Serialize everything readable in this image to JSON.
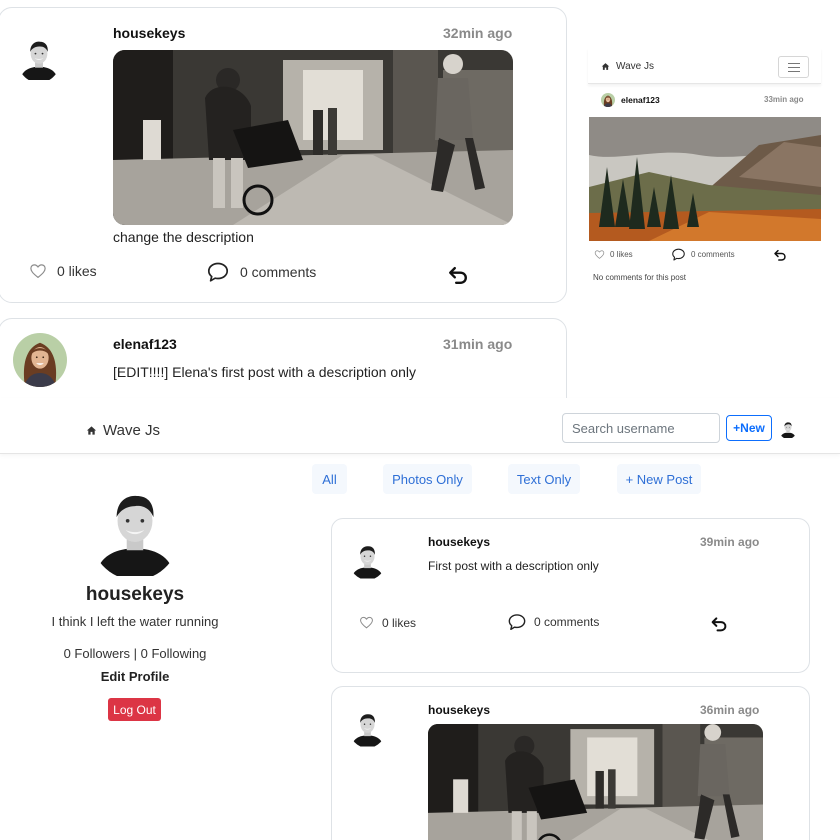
{
  "brand": {
    "name": "Wave Js"
  },
  "navbar": {
    "search_placeholder": "Search username",
    "new_label": "+New"
  },
  "mobile": {
    "brand_name": "Wave Js",
    "post": {
      "username": "elenaf123",
      "time": "33min ago",
      "likes": "0 likes",
      "comments": "0 comments",
      "no_comments": "No comments for this post"
    }
  },
  "feed_top": {
    "post1": {
      "username": "housekeys",
      "time": "32min ago",
      "description": "change the description",
      "likes": "0 likes",
      "comments": "0 comments"
    },
    "post2": {
      "username": "elenaf123",
      "time": "31min ago",
      "description": "[EDIT!!!!] Elena's first post with a description only"
    }
  },
  "tabs": [
    {
      "label": "All"
    },
    {
      "label": "Photos Only"
    },
    {
      "label": "Text Only"
    },
    {
      "label": "+ New Post"
    }
  ],
  "profile": {
    "username": "housekeys",
    "bio": "I think I left the water running",
    "followers": "0 Followers | 0 Following",
    "edit_label": "Edit Profile",
    "logout_label": "Log Out"
  },
  "feed_bottom": {
    "post1": {
      "username": "housekeys",
      "time": "39min ago",
      "description": "First post with a description only",
      "likes": "0 likes",
      "comments": "0 comments"
    },
    "post2": {
      "username": "housekeys",
      "time": "36min ago"
    }
  },
  "icons": [
    "home-icon",
    "heart-icon",
    "comment-icon",
    "share-icon",
    "hamburger-menu-icon"
  ]
}
